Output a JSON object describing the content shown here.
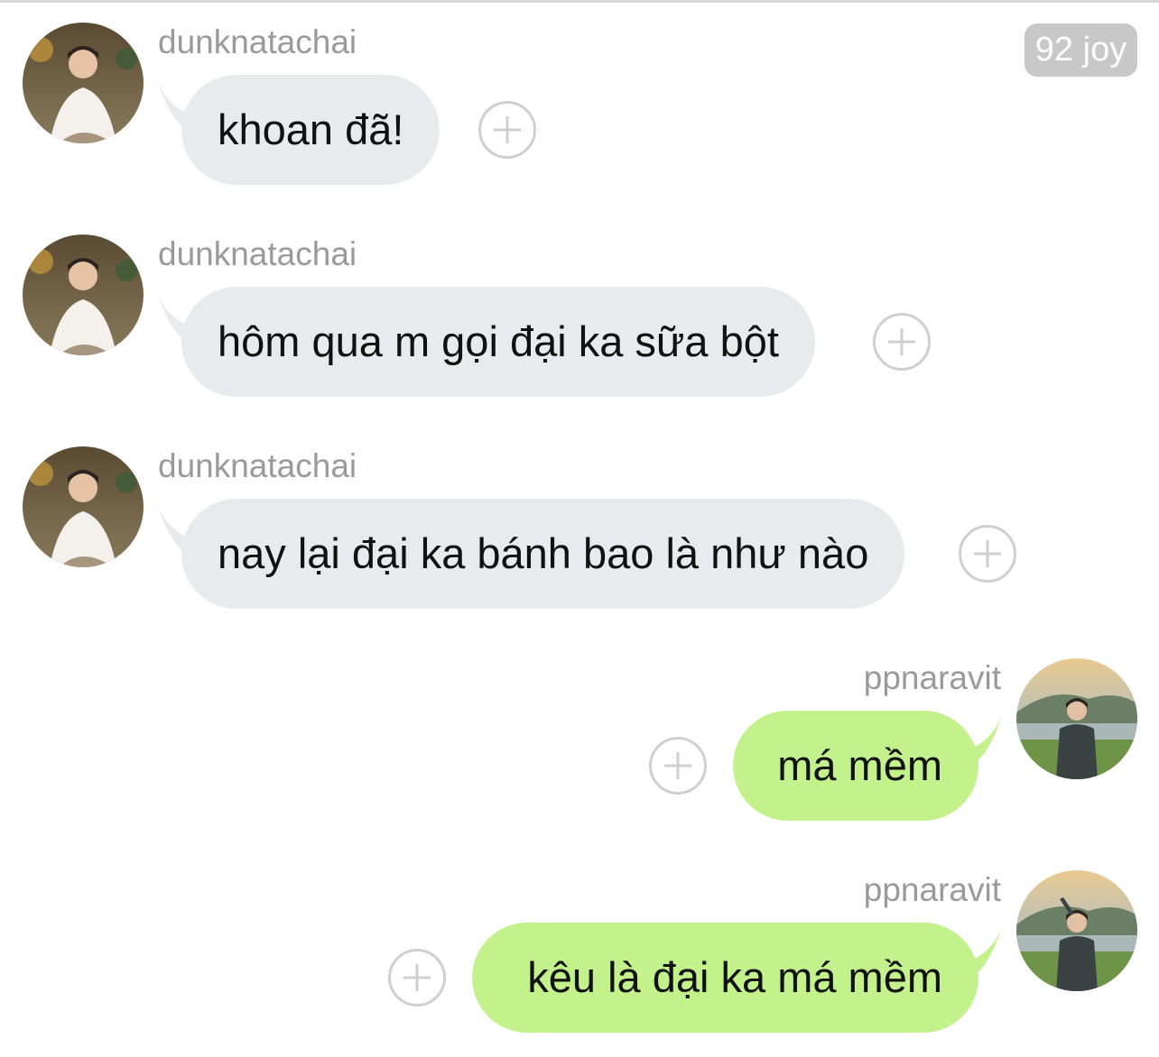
{
  "badge": {
    "label": "92 joy"
  },
  "messages": [
    {
      "sender": "dunknatachai",
      "text": "khoan đã!",
      "direction": "incoming"
    },
    {
      "sender": "dunknatachai",
      "text": "hôm qua m gọi đại ka sữa bột",
      "direction": "incoming"
    },
    {
      "sender": "dunknatachai",
      "text": "nay lại đại ka bánh bao là như nào",
      "direction": "incoming"
    },
    {
      "sender": "ppnaravit",
      "text": "má mềm",
      "direction": "outgoing"
    },
    {
      "sender": "ppnaravit",
      "text": "kêu là đại ka má mềm",
      "direction": "outgoing"
    }
  ],
  "colors": {
    "incoming_bubble": "#e8eaed",
    "outgoing_bubble": "#c3f28c",
    "sender_name": "#9a9a9a",
    "badge_bg": "#c8c8c8"
  },
  "icons": {
    "react": "plus-circle-icon"
  }
}
